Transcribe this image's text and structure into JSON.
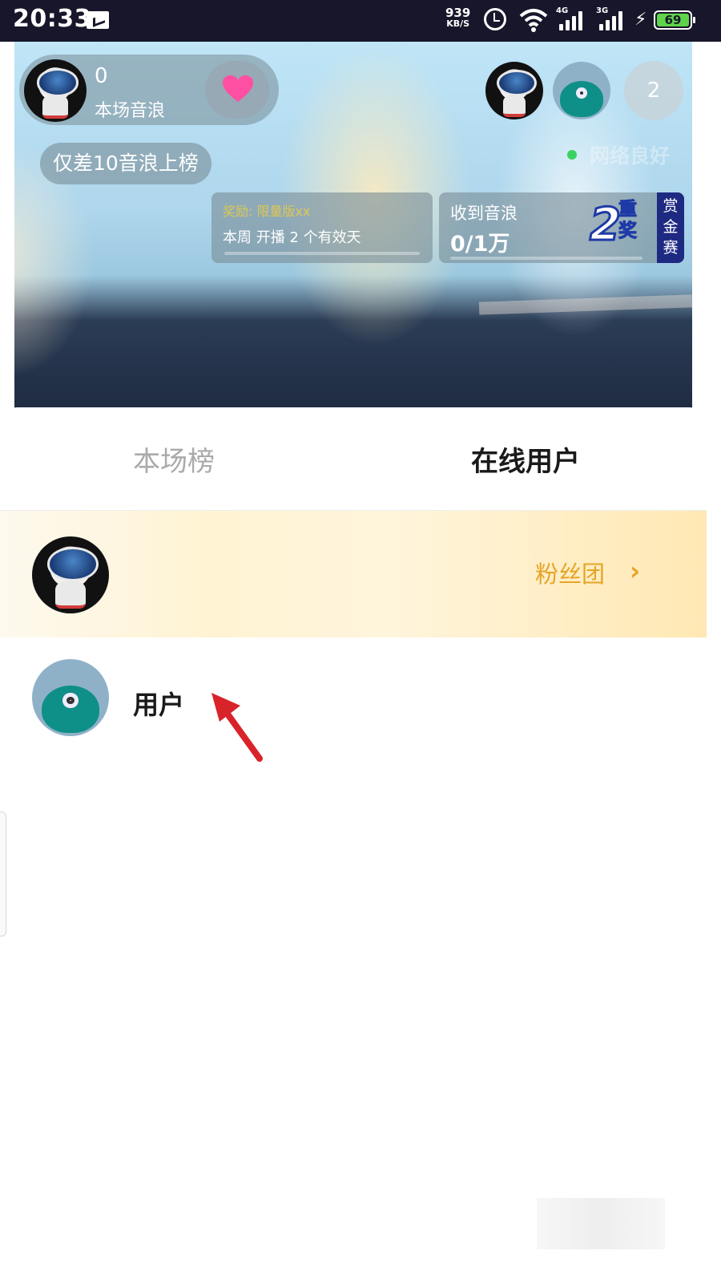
{
  "status_bar": {
    "time": "20:33",
    "net_speed_value": "939",
    "net_speed_unit": "KB/S",
    "sim1_type": "4G",
    "sim2_type": "3G",
    "battery_level": "69"
  },
  "live_room": {
    "host": {
      "wave_count": "0",
      "wave_label": "本场音浪"
    },
    "rank_tip": "仅差10音浪上榜",
    "viewer_count": "2",
    "network_status": "网络良好",
    "task_card": {
      "reward_text": "奖励: 限量版xx",
      "description": "本周  开播 2 个有效天"
    },
    "wave_card": {
      "label": "收到音浪",
      "value": "0/1万",
      "double_number": "2",
      "double_text": "重奖",
      "bounty_tag": "赏金赛"
    }
  },
  "sheet": {
    "tabs": [
      {
        "label": "本场榜",
        "active": false
      },
      {
        "label": "在线用户",
        "active": true
      }
    ],
    "fan_club": {
      "label": "粉丝团",
      "chevron": "›"
    },
    "users": [
      {
        "name": "用户"
      }
    ]
  },
  "colors": {
    "status_bar_bg": "#17162a",
    "fan_label": "#e6a528",
    "arrow": "#d9232a",
    "bounty_tag_bg": "#1e2a82",
    "network_dot": "#3bd262"
  },
  "icons": [
    "mail-icon",
    "alarm-icon",
    "wifi-icon",
    "signal-icon",
    "charging-icon",
    "battery-icon",
    "heart-icon",
    "chevron-right-icon",
    "arrow-annotation"
  ]
}
